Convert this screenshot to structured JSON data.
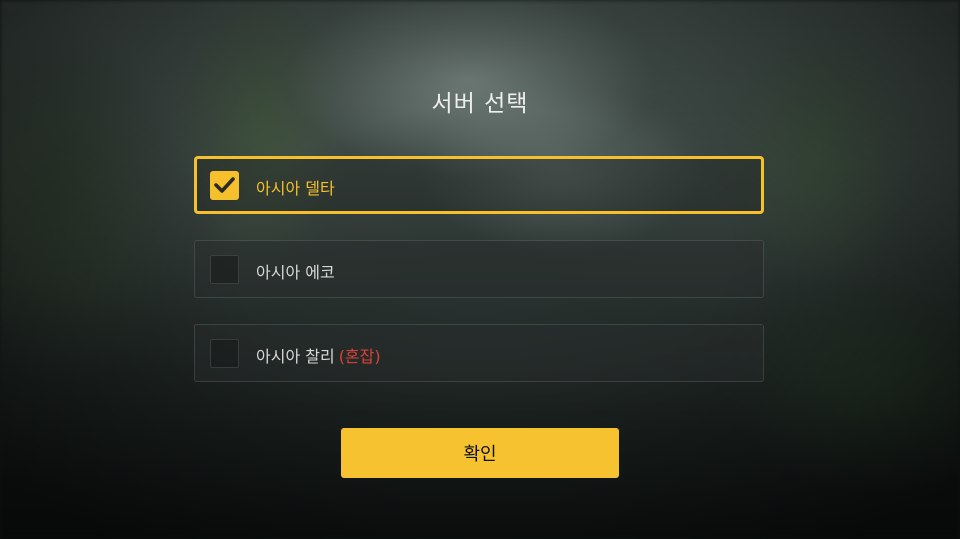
{
  "screen": {
    "title": "서버 선택"
  },
  "servers": [
    {
      "label": "아시아 델타",
      "tag": "",
      "selected": true
    },
    {
      "label": "아시아 에코",
      "tag": "",
      "selected": false
    },
    {
      "label": "아시아 찰리",
      "tag": "(혼잡)",
      "selected": false
    }
  ],
  "confirm": {
    "label": "확인"
  },
  "colors": {
    "accent": "#f5c02c",
    "congested": "#d9413a",
    "text": "#d8d8d8"
  },
  "icons": {
    "selected_check": "check-icon"
  }
}
